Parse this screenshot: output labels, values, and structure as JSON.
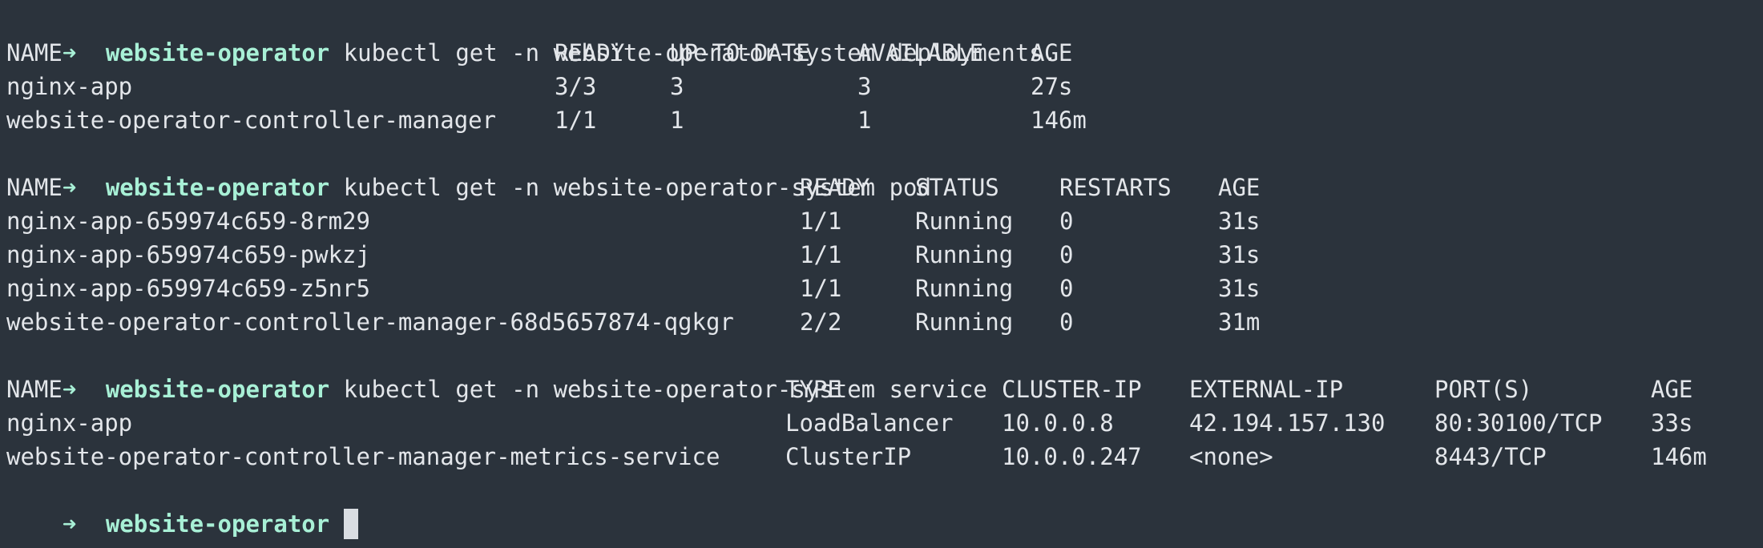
{
  "prompt": {
    "arrow": "➜",
    "dir": "website-operator"
  },
  "commands": {
    "deployments": "kubectl get -n website-operator-system deployments.",
    "pods": "kubectl get -n website-operator-system pod",
    "services": "kubectl get -n website-operator-system service"
  },
  "deployments": {
    "headers": [
      "NAME",
      "READY",
      "UP-TO-DATE",
      "AVAILABLE",
      "AGE"
    ],
    "rows": [
      [
        "nginx-app",
        "3/3",
        "3",
        "3",
        "27s"
      ],
      [
        "website-operator-controller-manager",
        "1/1",
        "1",
        "1",
        "146m"
      ]
    ]
  },
  "pods": {
    "headers": [
      "NAME",
      "READY",
      "STATUS",
      "RESTARTS",
      "AGE"
    ],
    "rows": [
      [
        "nginx-app-659974c659-8rm29",
        "1/1",
        "Running",
        "0",
        "31s"
      ],
      [
        "nginx-app-659974c659-pwkzj",
        "1/1",
        "Running",
        "0",
        "31s"
      ],
      [
        "nginx-app-659974c659-z5nr5",
        "1/1",
        "Running",
        "0",
        "31s"
      ],
      [
        "website-operator-controller-manager-68d5657874-qgkgr",
        "2/2",
        "Running",
        "0",
        "31m"
      ]
    ]
  },
  "services": {
    "headers": [
      "NAME",
      "TYPE",
      "CLUSTER-IP",
      "EXTERNAL-IP",
      "PORT(S)",
      "AGE"
    ],
    "rows": [
      [
        "nginx-app",
        "LoadBalancer",
        "10.0.0.8",
        "42.194.157.130",
        "80:30100/TCP",
        "33s"
      ],
      [
        "website-operator-controller-manager-metrics-service",
        "ClusterIP",
        "10.0.0.247",
        "<none>",
        "8443/TCP",
        "146m"
      ]
    ]
  },
  "colors": {
    "background": "#2b333c",
    "prompt": "#a8f0d6",
    "text": "#e3e6ea"
  }
}
